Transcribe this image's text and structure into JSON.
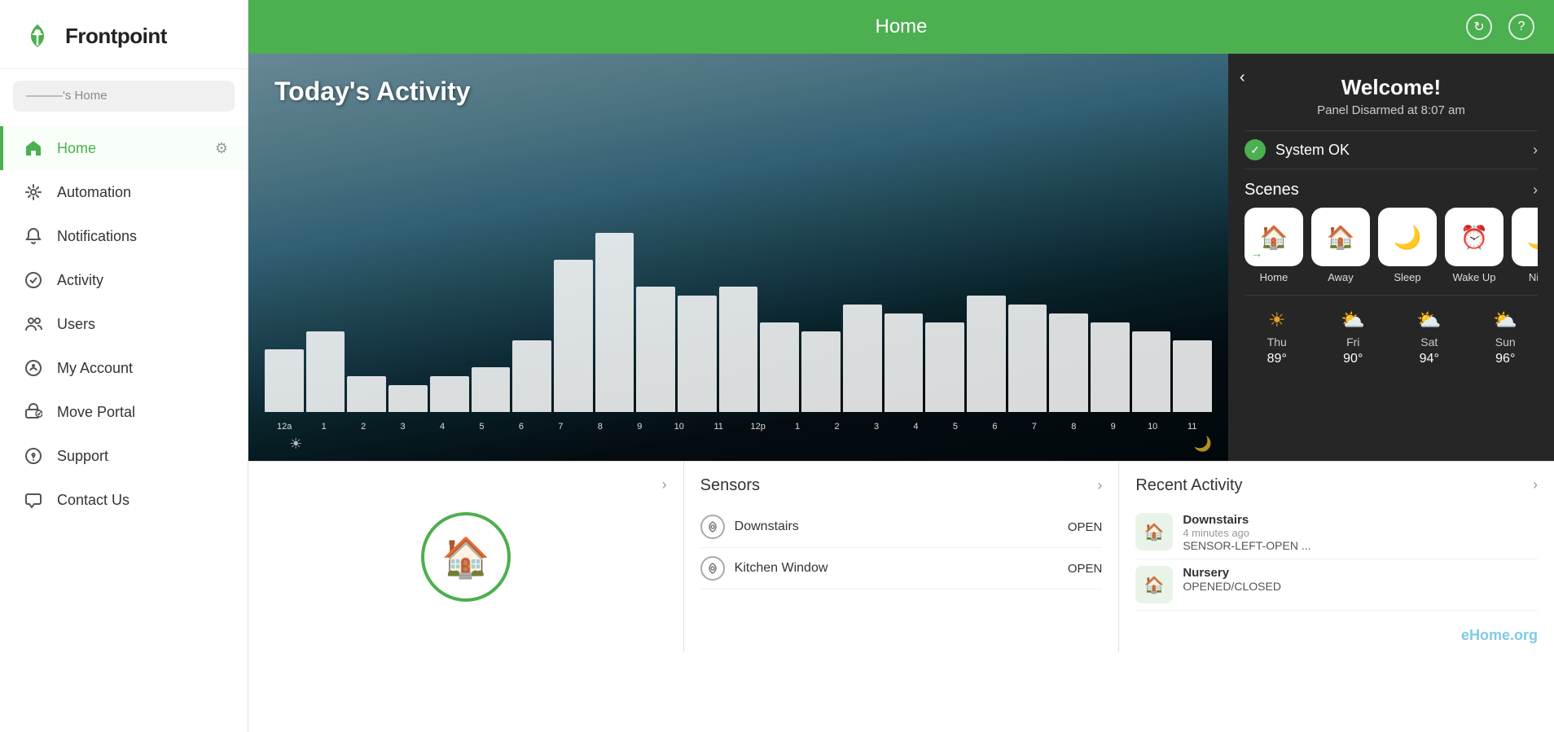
{
  "sidebar": {
    "logo_text": "Frontpoint",
    "home_selector": "———'s Home",
    "nav_items": [
      {
        "id": "home",
        "label": "Home",
        "icon": "🏠",
        "active": true
      },
      {
        "id": "automation",
        "label": "Automation",
        "icon": "⚙️",
        "active": false
      },
      {
        "id": "notifications",
        "label": "Notifications",
        "icon": "🔔",
        "active": false
      },
      {
        "id": "activity",
        "label": "Activity",
        "icon": "⏱",
        "active": false
      },
      {
        "id": "users",
        "label": "Users",
        "icon": "👥",
        "active": false
      },
      {
        "id": "my-account",
        "label": "My Account",
        "icon": "🛡",
        "active": false
      },
      {
        "id": "move-portal",
        "label": "Move Portal",
        "icon": "🚚",
        "active": false
      },
      {
        "id": "support",
        "label": "Support",
        "icon": "❓",
        "active": false
      },
      {
        "id": "contact-us",
        "label": "Contact Us",
        "icon": "📞",
        "active": false
      }
    ]
  },
  "topbar": {
    "title": "Home",
    "refresh_label": "↻",
    "help_label": "?"
  },
  "hero": {
    "activity_title": "Today's Activity",
    "chart_bars": [
      35,
      45,
      20,
      15,
      20,
      25,
      40,
      85,
      100,
      70,
      65,
      70,
      50,
      45,
      60,
      55,
      50,
      65,
      60,
      55,
      50,
      45,
      40
    ],
    "chart_labels": [
      "12a",
      "1",
      "2",
      "3",
      "4",
      "5",
      "6",
      "7",
      "8",
      "9",
      "10",
      "11",
      "12p",
      "1",
      "2",
      "3",
      "4",
      "5",
      "6",
      "7",
      "8",
      "9",
      "10",
      "11"
    ]
  },
  "welcome_panel": {
    "title": "Welcome!",
    "subtitle": "Panel Disarmed at 8:07 am",
    "system_status": "System OK",
    "scenes_title": "Scenes",
    "scenes": [
      {
        "label": "Home",
        "icon": "🏠",
        "color": "#4caf50"
      },
      {
        "label": "Away",
        "icon": "🏠",
        "color": "#e53935"
      },
      {
        "label": "Sleep",
        "icon": "🌙",
        "color": "#1565c0"
      },
      {
        "label": "Wake Up",
        "icon": "⏰",
        "color": "#f9a825"
      },
      {
        "label": "Night",
        "icon": "🌙",
        "color": "#1a237e"
      }
    ],
    "weather": [
      {
        "day": "Thu",
        "temp": "89°",
        "icon": "☀"
      },
      {
        "day": "Fri",
        "temp": "90°",
        "icon": "⛅"
      },
      {
        "day": "Sat",
        "temp": "94°",
        "icon": "⛅"
      },
      {
        "day": "Sun",
        "temp": "96°",
        "icon": "⛅"
      }
    ]
  },
  "security_panel": {
    "chevron": "›"
  },
  "sensors_panel": {
    "title": "Sensors",
    "sensors": [
      {
        "name": "Downstairs",
        "status": "OPEN"
      },
      {
        "name": "Kitchen Window",
        "status": "OPEN"
      }
    ]
  },
  "recent_activity_panel": {
    "title": "Recent Activity",
    "items": [
      {
        "name": "Downstairs",
        "time": "4 minutes ago",
        "desc": "SENSOR-LEFT-OPEN ..."
      },
      {
        "name": "Nursery",
        "time": "",
        "desc": "OPENED/CLOSED"
      }
    ]
  }
}
